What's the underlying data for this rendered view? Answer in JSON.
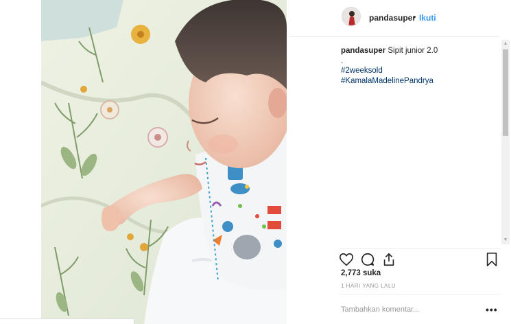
{
  "post": {
    "username": "pandasuper",
    "separator": "•",
    "follow_label": "Ikuti",
    "caption_username": "pandasuper",
    "caption_text": "Sipit junior 2.0",
    "caption_dot": ".",
    "hashtags": [
      "#2weeksold",
      "#KamalaMadelinePandrya"
    ],
    "likes": "2,773 suka",
    "timestamp": "1 HARI YANG LALU",
    "comment_placeholder": "Tambahkan komentar...",
    "more_label": "•••"
  },
  "icons": {
    "like": "heart-icon",
    "comment": "comment-bubble-icon",
    "share": "share-icon",
    "save": "bookmark-icon",
    "more": "more-options-icon"
  },
  "colors": {
    "link": "#3897f0",
    "hashtag": "#003569",
    "muted": "#999999",
    "text": "#262626"
  }
}
